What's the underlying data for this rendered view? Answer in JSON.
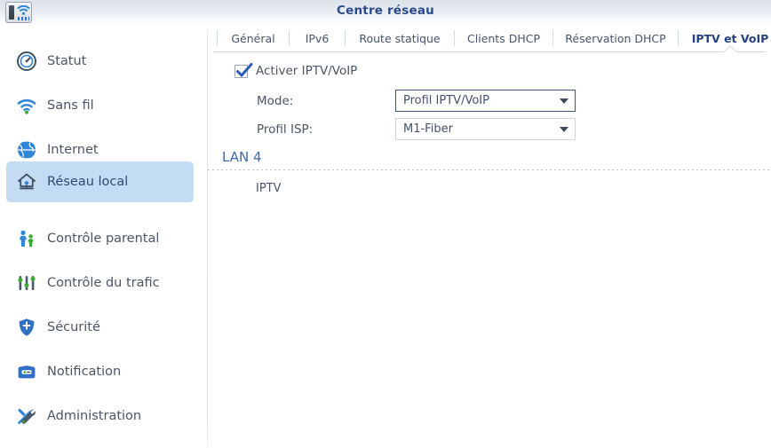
{
  "window": {
    "title": "Centre réseau",
    "app_icon": "router-wifi-icon"
  },
  "sidebar": {
    "items": [
      {
        "id": "statut",
        "label": "Statut",
        "icon": "gauge-icon",
        "selected": false
      },
      {
        "id": "sans-fil",
        "label": "Sans fil",
        "icon": "wifi-icon",
        "selected": false
      },
      {
        "id": "internet",
        "label": "Internet",
        "icon": "globe-icon",
        "selected": false
      },
      {
        "id": "reseau-local",
        "label": "Réseau local",
        "icon": "home-network-icon",
        "selected": true
      },
      {
        "id": "controle-parental",
        "label": "Contrôle parental",
        "icon": "people-icon",
        "selected": false
      },
      {
        "id": "controle-trafic",
        "label": "Contrôle du trafic",
        "icon": "sliders-icon",
        "selected": false
      },
      {
        "id": "securite",
        "label": "Sécurité",
        "icon": "shield-icon",
        "selected": false
      },
      {
        "id": "notification",
        "label": "Notification",
        "icon": "envelope-icon",
        "selected": false
      },
      {
        "id": "administration",
        "label": "Administration",
        "icon": "tools-icon",
        "selected": false
      }
    ]
  },
  "tabs": [
    {
      "id": "general",
      "label": "Général",
      "active": false
    },
    {
      "id": "ipv6",
      "label": "IPv6",
      "active": false
    },
    {
      "id": "route-statique",
      "label": "Route statique",
      "active": false
    },
    {
      "id": "clients-dhcp",
      "label": "Clients DHCP",
      "active": false
    },
    {
      "id": "reservation-dhcp",
      "label": "Réservation DHCP",
      "active": false
    },
    {
      "id": "iptv-voip",
      "label": "IPTV et VoIP",
      "active": true
    }
  ],
  "form": {
    "enable_checkbox": {
      "label": "Activer IPTV/VoIP",
      "checked": true
    },
    "mode": {
      "label": "Mode:",
      "value": "Profil IPTV/VoIP",
      "options": [
        "Profil IPTV/VoIP"
      ]
    },
    "isp_profile": {
      "label": "Profil ISP:",
      "value": "M1-Fiber",
      "options": [
        "M1-Fiber"
      ]
    }
  },
  "section": {
    "title": "LAN 4",
    "row_label": "IPTV"
  },
  "colors": {
    "accent_blue": "#2b4a8b",
    "selected_bg": "#c3dcf4",
    "section_blue": "#3f6ba8",
    "text": "#4b5665",
    "focus_border": "#3e5878"
  }
}
